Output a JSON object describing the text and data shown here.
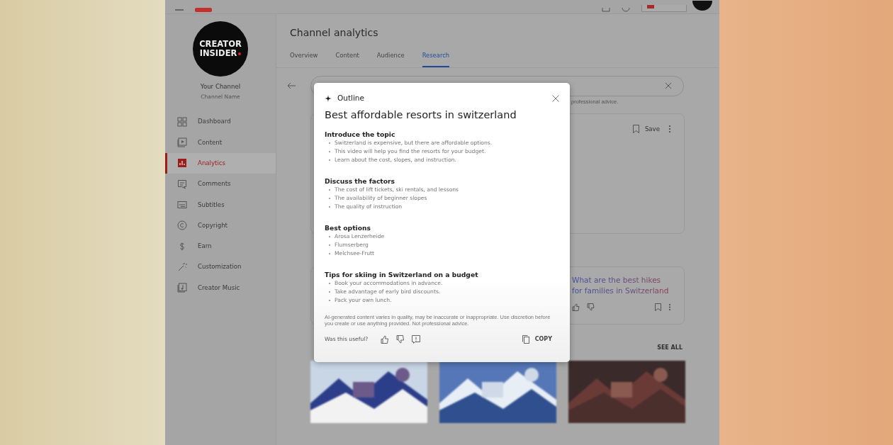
{
  "sidebar": {
    "logo_lines": [
      "CREATOR",
      "INSIDER"
    ],
    "channel_name": "Your Channel",
    "channel_subtitle": "Channel Name",
    "items": [
      {
        "label": "Dashboard",
        "selected": false
      },
      {
        "label": "Content",
        "selected": false
      },
      {
        "label": "Analytics",
        "selected": true
      },
      {
        "label": "Comments",
        "selected": false
      },
      {
        "label": "Subtitles",
        "selected": false
      },
      {
        "label": "Copyright",
        "selected": false
      },
      {
        "label": "Earn",
        "selected": false
      },
      {
        "label": "Customization",
        "selected": false
      },
      {
        "label": "Creator Music",
        "selected": false
      }
    ]
  },
  "page": {
    "title": "Channel analytics",
    "tabs": [
      {
        "label": "Overview",
        "selected": false
      },
      {
        "label": "Content",
        "selected": false
      },
      {
        "label": "Audience",
        "selected": false
      },
      {
        "label": "Research",
        "selected": true
      }
    ],
    "search_note": "professional advice.",
    "save": "Save",
    "suggestion": "What are the best hikes for families in Switzerland",
    "see_all": "SEE ALL"
  },
  "dialog": {
    "label": "Outline",
    "title": "Best affordable resorts in switzerland",
    "sections": [
      {
        "heading": "Introduce the topic",
        "bullets": [
          "Switzerland is expensive, but there are affordable options.",
          "This video will help you find the resorts for your budget.",
          "Learn about the cost, slopes, and instruction."
        ]
      },
      {
        "heading": "Discuss the factors",
        "bullets": [
          "The cost of lift tickets, ski rentals, and lessons",
          "The availability of beginner slopes",
          "The quality of instruction"
        ]
      },
      {
        "heading": "Best options",
        "bullets": [
          "Arosa Lenzerheide",
          "Flumserberg",
          "Melchsee-Frutt"
        ]
      },
      {
        "heading": "Tips for skiing in Switzerland on a budget",
        "bullets": [
          "Book your accommodations in advance.",
          "Take advantage of early bird discounts.",
          "Pack your own lunch."
        ]
      }
    ],
    "disclaimer": "AI-generated content varies in quality, may be inaccurate or inappropriate. Use discretion before you create or use anything provided. Not professional advice.",
    "feedback_prompt": "Was this useful?",
    "copy": "COPY"
  }
}
